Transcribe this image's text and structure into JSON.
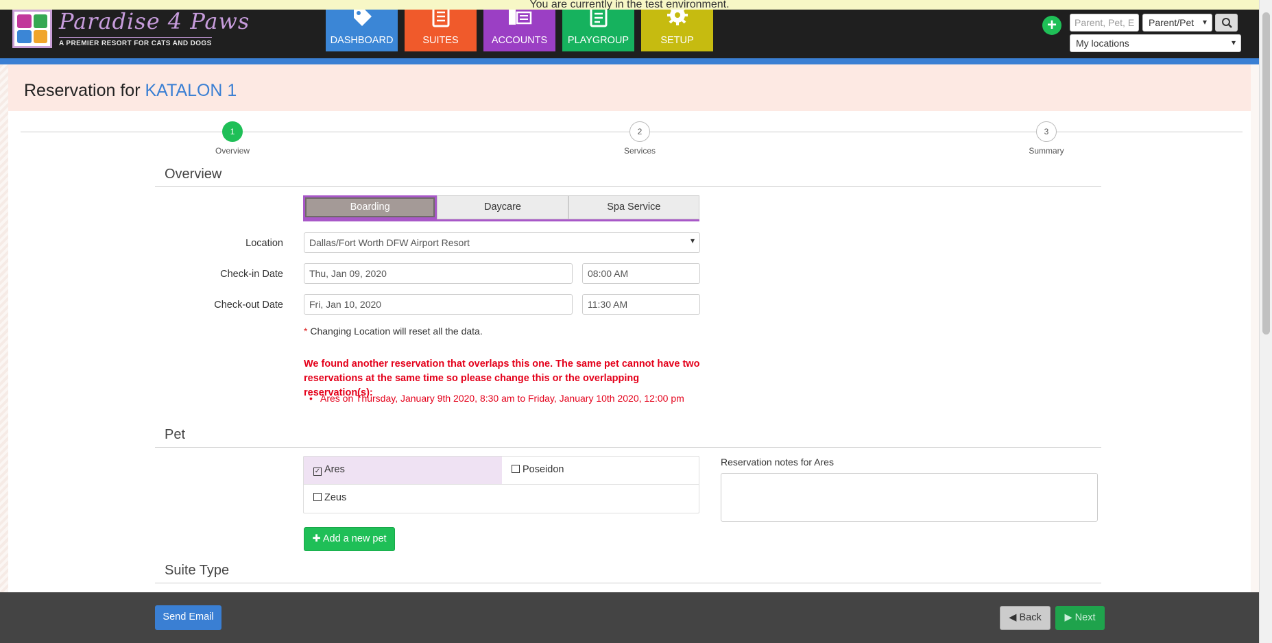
{
  "env_banner": "You are currently in the test environment.",
  "brand": {
    "name": "Paradise 4 Paws",
    "tagline": "A PREMIER RESORT FOR CATS AND DOGS"
  },
  "nav": [
    {
      "label": "DASHBOARD",
      "icon": "tag-icon",
      "color": "#3b86d6"
    },
    {
      "label": "SUITES",
      "icon": "list-icon",
      "color": "#f05a2b"
    },
    {
      "label": "ACCOUNTS",
      "icon": "id-card-icon",
      "color": "#9b3fc4"
    },
    {
      "label": "PLAYGROUP",
      "icon": "clipboard-icon",
      "color": "#16b25e"
    },
    {
      "label": "SETUP",
      "icon": "gear-icon",
      "color": "#c6bb10"
    }
  ],
  "header_search": {
    "placeholder": "Parent, Pet, E",
    "type_select": "Parent/Pet",
    "locations_select": "My locations"
  },
  "page": {
    "title_prefix": "Reservation for",
    "title_name": "KATALON 1"
  },
  "steps": [
    {
      "number": "1",
      "label": "Overview",
      "active": true
    },
    {
      "number": "2",
      "label": "Services",
      "active": false
    },
    {
      "number": "3",
      "label": "Summary",
      "active": false
    }
  ],
  "sections": {
    "overview": "Overview",
    "pet": "Pet",
    "suite_type": "Suite Type"
  },
  "service_types": [
    {
      "label": "Boarding",
      "active": true
    },
    {
      "label": "Daycare",
      "active": false
    },
    {
      "label": "Spa Service",
      "active": false
    }
  ],
  "form": {
    "location_label": "Location",
    "location_value": "Dallas/Fort Worth DFW Airport Resort",
    "checkin_label": "Check-in Date",
    "checkin_date": "Thu, Jan 09, 2020",
    "checkin_time": "08:00 AM",
    "checkout_label": "Check-out Date",
    "checkout_date": "Fri, Jan 10, 2020",
    "checkout_time": "11:30 AM",
    "note_star": "*",
    "note_text": "Changing Location will reset all the data."
  },
  "warning": {
    "message": "We found another reservation that overlaps this one. The same pet cannot have two reservations at the same time so please change this or the overlapping reservation(s):",
    "items": [
      "Ares on Thursday, January 9th 2020, 8:30 am to Friday, January 10th 2020, 12:00 pm"
    ]
  },
  "pets": [
    {
      "name": "Ares",
      "checked": true
    },
    {
      "name": "Poseidon",
      "checked": false
    },
    {
      "name": "Zeus",
      "checked": false
    }
  ],
  "notes_label": "Reservation notes for Ares",
  "add_pet_label": "Add a new pet",
  "footer": {
    "send_email": "Send Email",
    "back": "Back",
    "next": "Next"
  }
}
